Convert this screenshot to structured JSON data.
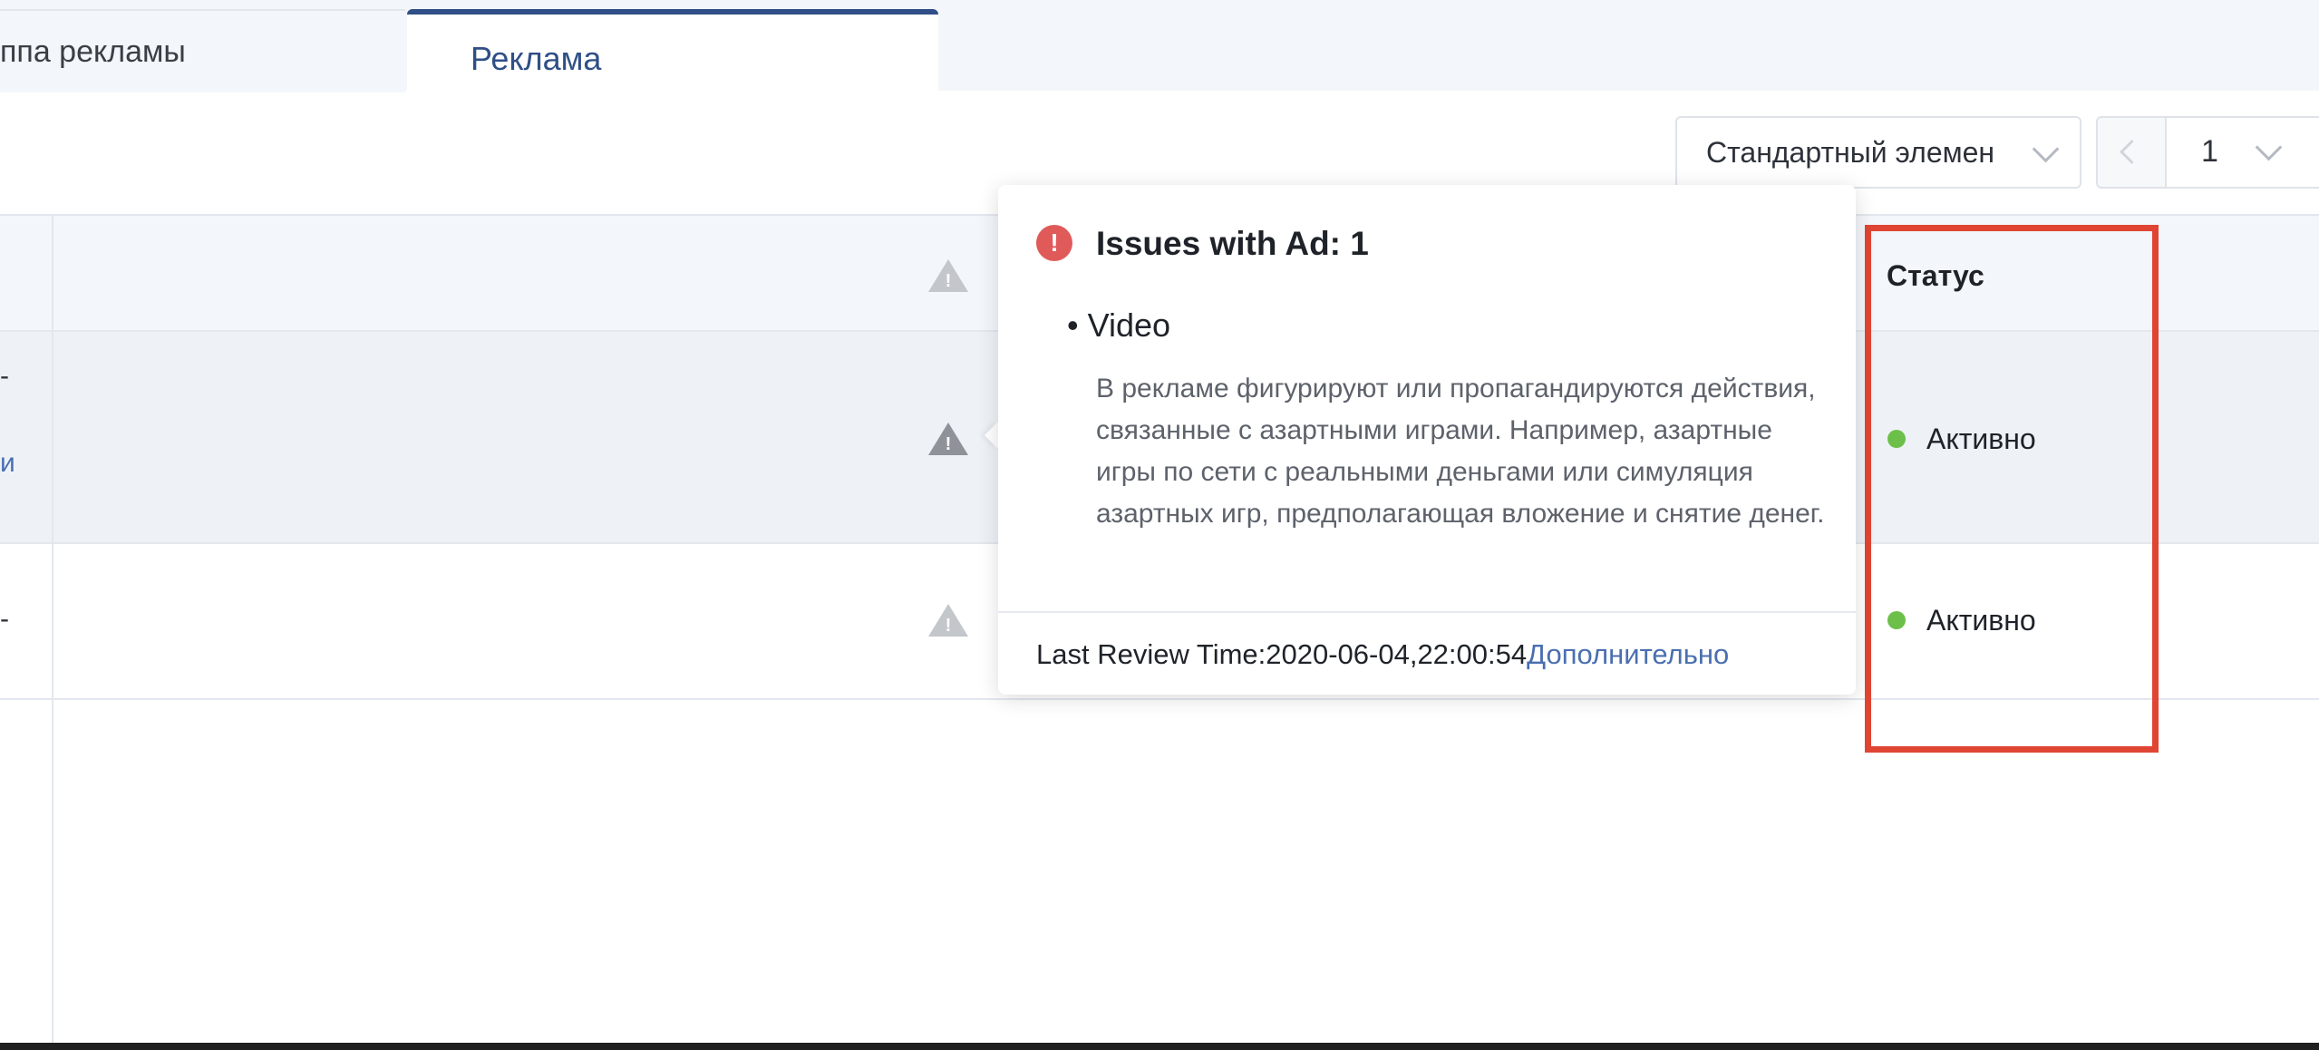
{
  "tabs": [
    {
      "label": "ппа рекламы"
    },
    {
      "label": "Реклама"
    }
  ],
  "toolbar": {
    "view_select": "Стандартный элемен",
    "page_number": "1"
  },
  "table": {
    "status_header": "Статус",
    "rows": [
      {
        "left_text": "-",
        "left_link": "и",
        "status": "Активно"
      },
      {
        "left_text": "-",
        "status": "Активно"
      }
    ]
  },
  "popover": {
    "title": "Issues with Ad: 1",
    "bullet": "• Video",
    "description": "В рекламе фигурируют или пропагандируются действия, связанные с азартными играми. Например, азартные игры по сети с реальными деньгами или симуляция азартных игр, предполагающая вложение и снятие денег.",
    "review_time": "Last Review Time:2020-06-04,22:00:54",
    "more_link": "Дополнительно"
  },
  "colors": {
    "accent": "#2f4f86",
    "link": "#4a6fb0",
    "status_active": "#6cc04a",
    "highlight": "#e04533",
    "error": "#e05a5a"
  }
}
